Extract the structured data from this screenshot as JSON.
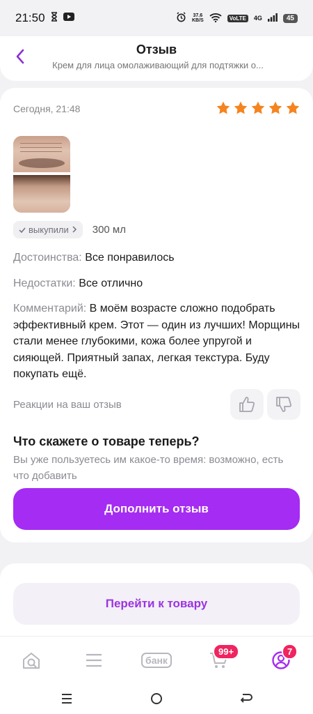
{
  "status_bar": {
    "time": "21:50",
    "speed_value": "37.6",
    "speed_unit": "KB/S",
    "volte": "VoLTE",
    "network": "4G",
    "battery": "45"
  },
  "header": {
    "title": "Отзыв",
    "subtitle": "Крем для лица омолаживающий для подтяжки о..."
  },
  "review": {
    "date": "Сегодня, 21:48",
    "rating": 5,
    "rating_max": 5,
    "star_color": "#f5841f",
    "bought_label": "выкупили",
    "volume": "300 мл",
    "pros_label": "Достоинства:",
    "pros_text": "Все понравилось",
    "cons_label": "Недостатки:",
    "cons_text": "Все отлично",
    "comment_label": "Комментарий:",
    "comment_text": "В моём возрасте сложно подобрать эффективный крем. Этот — один из лучших! Морщины стали менее глубокими, кожа более упругой и сияющей. Приятный запах, легкая текстура. Буду покупать ещё.",
    "reactions_label": "Реакции на ваш отзыв"
  },
  "prompt": {
    "title": "Что скажете о товаре теперь?",
    "subtitle": "Вы уже пользуетесь им какое-то время: возможно, есть что добавить",
    "button": "Дополнить отзыв"
  },
  "goto_button": "Перейти к товару",
  "tabbar": {
    "bank_label": "банк",
    "cart_badge": "99+",
    "profile_badge": "7"
  },
  "colors": {
    "accent": "#a52cf2",
    "accent_text": "#9b34e0",
    "badge": "#f0245f"
  }
}
